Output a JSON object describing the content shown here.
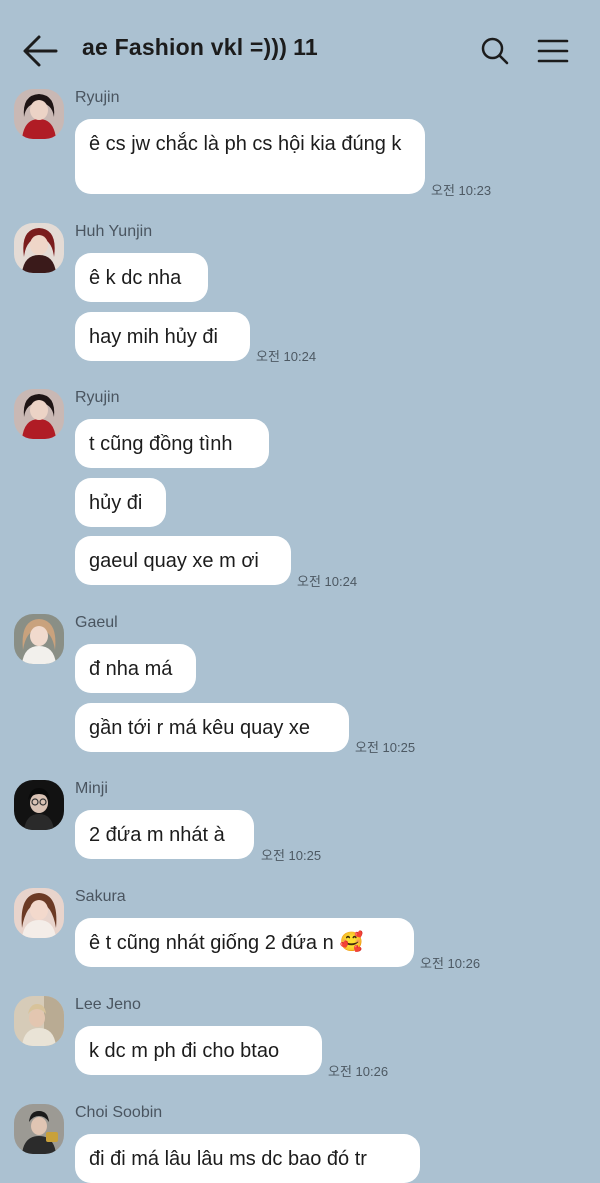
{
  "header": {
    "title": "ae Fashion vkl =)))",
    "member_count": "11",
    "back_icon": "arrow-left-icon",
    "search_icon": "search-icon",
    "menu_icon": "hamburger-menu-icon"
  },
  "messages": [
    {
      "sender": "Ryujin",
      "bubbles": [
        "ê cs jw chắc là ph cs hội kia đúng k"
      ],
      "time": "오전 10:23"
    },
    {
      "sender": "Huh Yunjin",
      "bubbles": [
        "ê k dc nha",
        "hay mih hủy đi"
      ],
      "time": "오전 10:24"
    },
    {
      "sender": "Ryujin",
      "bubbles": [
        "t cũng đồng tình",
        "hủy đi",
        "gaeul quay xe m ơi"
      ],
      "time": "오전 10:24"
    },
    {
      "sender": "Gaeul",
      "bubbles": [
        "đ nha má",
        "gần tới r má kêu quay xe"
      ],
      "time": "오전 10:25"
    },
    {
      "sender": "Minji",
      "bubbles": [
        "2 đứa m nhát à"
      ],
      "time": "오전 10:25"
    },
    {
      "sender": "Sakura",
      "bubbles": [
        "ê t cũng nhát giống 2 đứa n"
      ],
      "emoji": "🥰",
      "time": "오전 10:26"
    },
    {
      "sender": "Lee Jeno",
      "bubbles": [
        "k dc m ph đi cho btao"
      ],
      "time": "오전 10:26"
    },
    {
      "sender": "Choi Soobin",
      "bubbles": [
        "đi đi má lâu lâu ms dc bao đó tr"
      ],
      "time": ""
    }
  ]
}
